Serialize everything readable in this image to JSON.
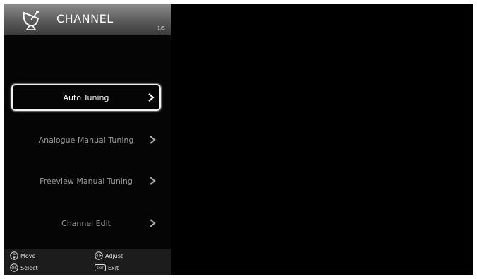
{
  "header": {
    "title": "CHANNEL",
    "icon": "satellite-dish-icon",
    "page_indicator": "1/5"
  },
  "menu": {
    "items": [
      {
        "label": "Auto Tuning",
        "selected": true
      },
      {
        "label": "Analogue Manual Tuning",
        "selected": false
      },
      {
        "label": "Freeview Manual Tuning",
        "selected": false
      },
      {
        "label": "Channel Edit",
        "selected": false
      }
    ]
  },
  "footer": {
    "move_label": "Move",
    "select_label": "Select",
    "adjust_label": "Adjust",
    "exit_label": "Exit",
    "select_key": "OK",
    "exit_key": "EXIT"
  },
  "colors": {
    "background": "#000000",
    "selected_border": "#f2f2f2",
    "item_text": "#9a9a9a",
    "selected_text": "#ffffff"
  }
}
